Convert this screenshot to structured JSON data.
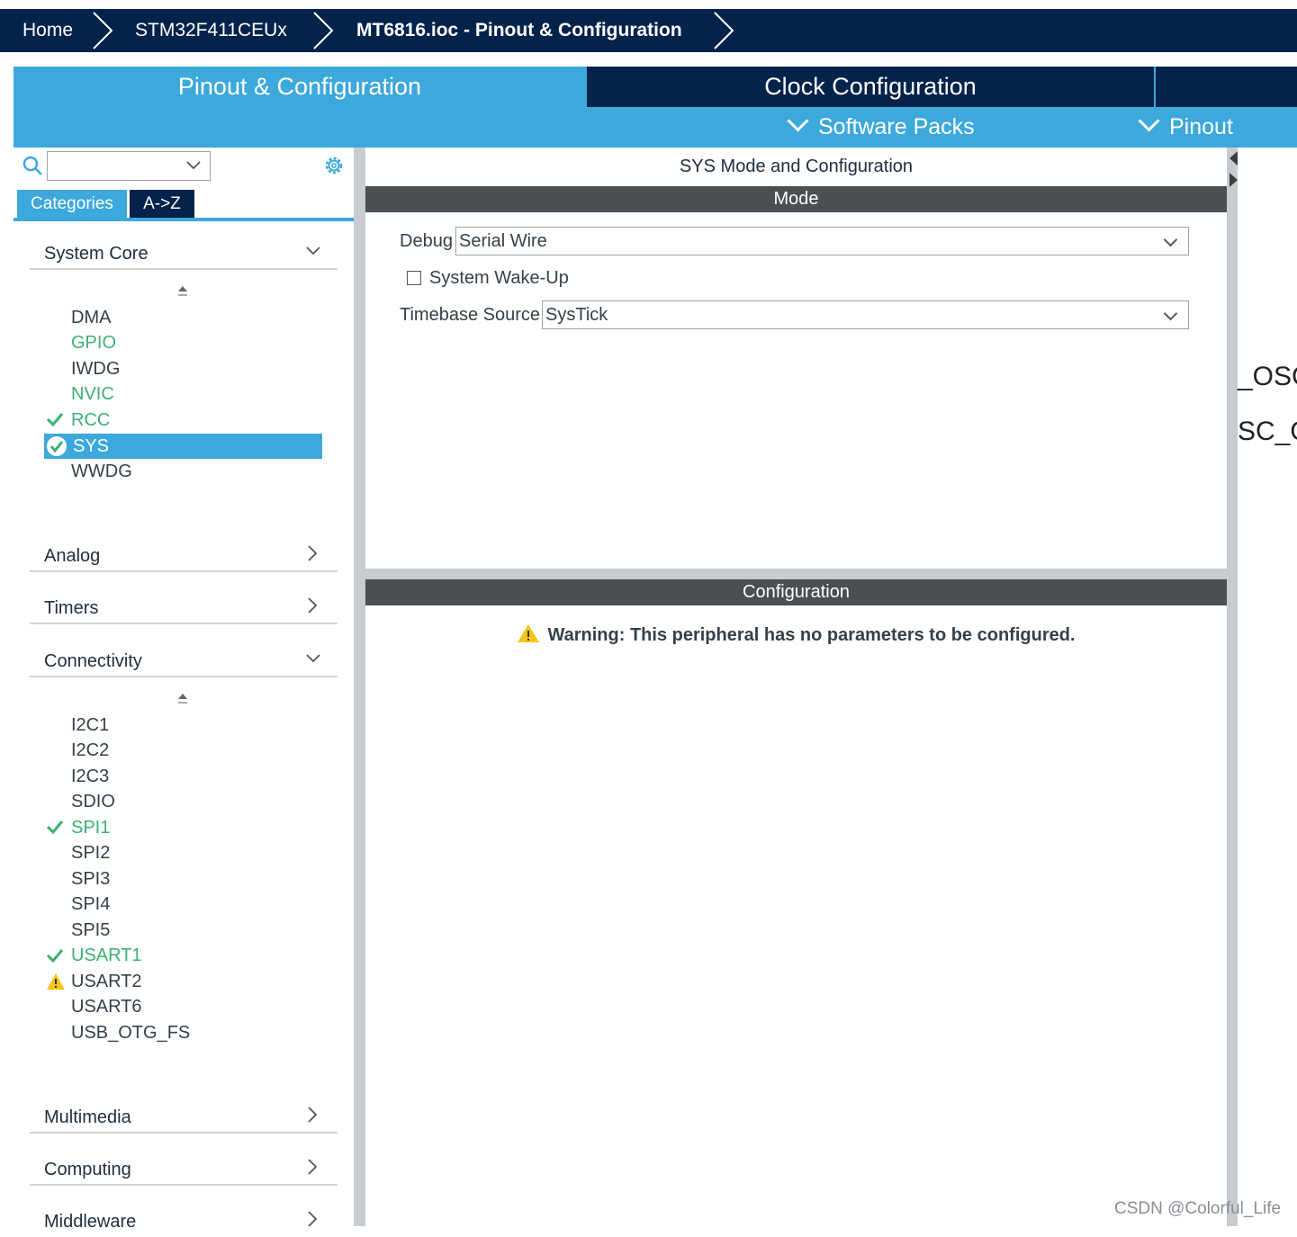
{
  "breadcrumb": {
    "home": "Home",
    "mcu": "STM32F411CEUx",
    "project": "MT6816.ioc - Pinout & Configuration"
  },
  "tabs": {
    "pinout": "Pinout & Configuration",
    "clock": "Clock Configuration",
    "software_packs": "Software Packs",
    "pinout_menu": "Pinout"
  },
  "sidebar": {
    "search_value": "",
    "tab_categories": "Categories",
    "tab_az": "A->Z",
    "categories": [
      {
        "label": "System Core",
        "expanded": true
      },
      {
        "label": "Analog",
        "expanded": false
      },
      {
        "label": "Timers",
        "expanded": false
      },
      {
        "label": "Connectivity",
        "expanded": true
      },
      {
        "label": "Multimedia",
        "expanded": false
      },
      {
        "label": "Computing",
        "expanded": false
      },
      {
        "label": "Middleware",
        "expanded": false
      }
    ],
    "system_core_items": [
      {
        "label": "DMA",
        "status": "none"
      },
      {
        "label": "GPIO",
        "status": "green"
      },
      {
        "label": "IWDG",
        "status": "none"
      },
      {
        "label": "NVIC",
        "status": "green"
      },
      {
        "label": "RCC",
        "status": "check"
      },
      {
        "label": "SYS",
        "status": "selected"
      },
      {
        "label": "WWDG",
        "status": "none"
      }
    ],
    "connectivity_items": [
      {
        "label": "I2C1",
        "status": "none"
      },
      {
        "label": "I2C2",
        "status": "none"
      },
      {
        "label": "I2C3",
        "status": "none"
      },
      {
        "label": "SDIO",
        "status": "none"
      },
      {
        "label": "SPI1",
        "status": "check"
      },
      {
        "label": "SPI2",
        "status": "none"
      },
      {
        "label": "SPI3",
        "status": "none"
      },
      {
        "label": "SPI4",
        "status": "none"
      },
      {
        "label": "SPI5",
        "status": "none"
      },
      {
        "label": "USART1",
        "status": "check"
      },
      {
        "label": "USART2",
        "status": "warning"
      },
      {
        "label": "USART6",
        "status": "none"
      },
      {
        "label": "USB_OTG_FS",
        "status": "none"
      }
    ]
  },
  "main": {
    "title": "SYS Mode and Configuration",
    "mode_header": "Mode",
    "debug_label": "Debug",
    "debug_value": "Serial Wire",
    "wakeup_label": "System Wake-Up",
    "wakeup_checked": false,
    "timebase_label": "Timebase Source",
    "timebase_value": "SysTick",
    "config_header": "Configuration",
    "warning_text": "Warning: This peripheral has no parameters to be configured."
  },
  "canvas": {
    "pin_label_1": "_OSC",
    "pin_label_2": "SC_O"
  },
  "watermark": "CSDN @Colorful_Life",
  "colors": {
    "nav_dark": "#03234b",
    "accent_blue": "#3ca8dc",
    "status_green": "#3bb173",
    "warning_yellow": "#f5c518",
    "header_gray": "#4b4f54"
  }
}
